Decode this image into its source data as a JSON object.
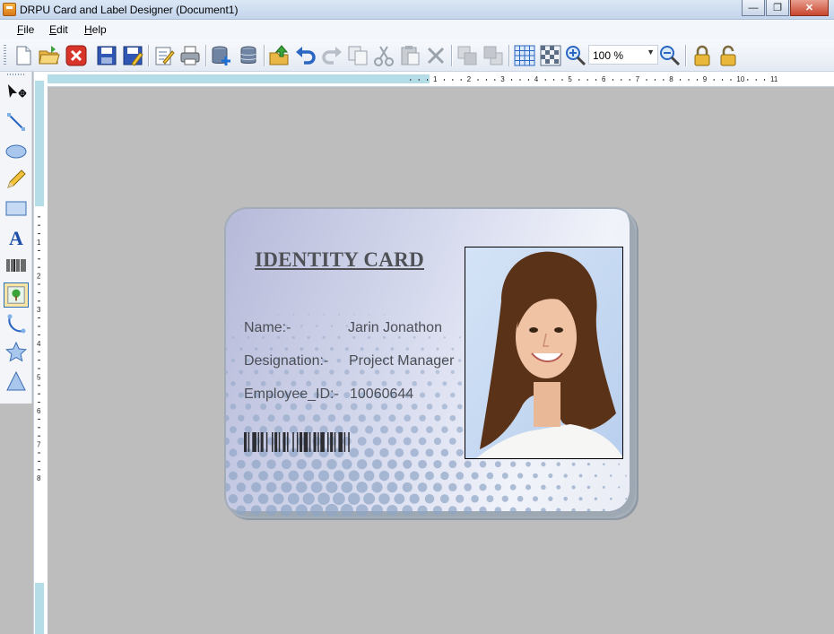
{
  "window": {
    "title": "DRPU Card and Label Designer  (Document1)"
  },
  "menu": {
    "items": [
      "File",
      "Edit",
      "Help"
    ]
  },
  "toolbar": {
    "zoom_value": "100 %"
  },
  "tools": [
    "select-tool",
    "line-tool",
    "ellipse-tool",
    "pencil-tool",
    "rectangle-tool",
    "text-tool",
    "barcode-tool",
    "picture-tool",
    "arc-tool",
    "star-tool",
    "triangle-tool"
  ],
  "rulers": {
    "horizontal_ticks": [
      "1",
      "2",
      "3",
      "4",
      "5",
      "6",
      "7",
      "8",
      "9",
      "10",
      "11"
    ],
    "vertical_ticks": [
      "1",
      "2",
      "3",
      "4",
      "5",
      "6",
      "7",
      "8"
    ]
  },
  "card": {
    "title": "IDENTITY CARD",
    "fields": [
      {
        "label": "Name:-",
        "value": "Jarin Jonathon"
      },
      {
        "label": "Designation:-",
        "value": "Project Manager"
      },
      {
        "label": "Employee_ID:-",
        "value": "10060644"
      }
    ]
  },
  "colors": {
    "card_gradient_start": "#b6bad9",
    "card_gradient_end": "#f1f3fa",
    "text": "#4c4e55",
    "ruler_band": "#b5dde8",
    "canvas": "#bdbdbd"
  }
}
